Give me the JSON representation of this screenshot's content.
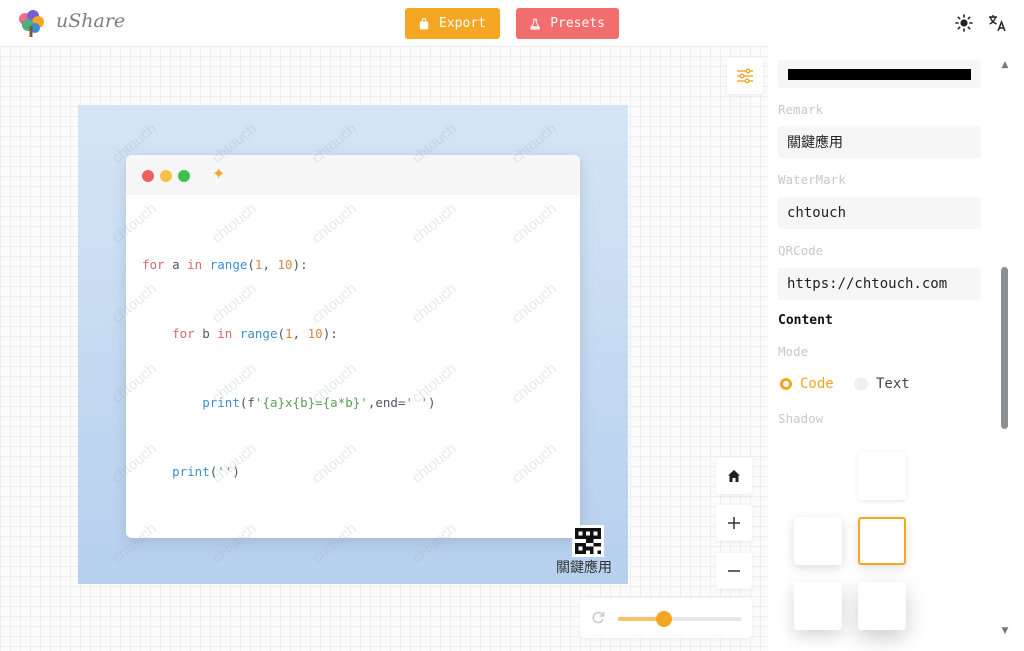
{
  "app": {
    "brand": "uShare"
  },
  "toolbar": {
    "export_label": "Export",
    "presets_label": "Presets"
  },
  "icons": {
    "logo": "tree-logo",
    "export": "bag-icon",
    "presets": "flask-icon",
    "theme": "sun-icon",
    "language": "translate-icon",
    "settings": "sliders-icon",
    "home": "home-icon",
    "zoom_in": "plus-icon",
    "zoom_out": "minus-icon",
    "reset": "refresh-icon"
  },
  "colors": {
    "export": "#f5a623",
    "presets": "#f26d6d",
    "accent": "#f5a623",
    "code_bg_top": "#d6e5f5",
    "code_bg_bottom": "#b6d0ee"
  },
  "code": {
    "lines": [
      "for a in range(1, 10):",
      "    for b in range(1, 10):",
      "        print(f'{a}x{b}={a*b}',end=' ')",
      "    print('')"
    ]
  },
  "canvas": {
    "watermark": "chtouch",
    "remark": "關鍵應用"
  },
  "zoom": {
    "level": 0.35
  },
  "panel": {
    "remark": {
      "label": "Remark",
      "value": "關鍵應用"
    },
    "watermark": {
      "label": "WaterMark",
      "value": "chtouch"
    },
    "qrcode": {
      "label": "QRCode",
      "value": "https://chtouch.com"
    },
    "content_section": "Content",
    "mode": {
      "label": "Mode",
      "options": [
        "Code",
        "Text"
      ],
      "selected": "Code"
    },
    "shadow": {
      "label": "Shadow",
      "selected_index": 3
    }
  }
}
